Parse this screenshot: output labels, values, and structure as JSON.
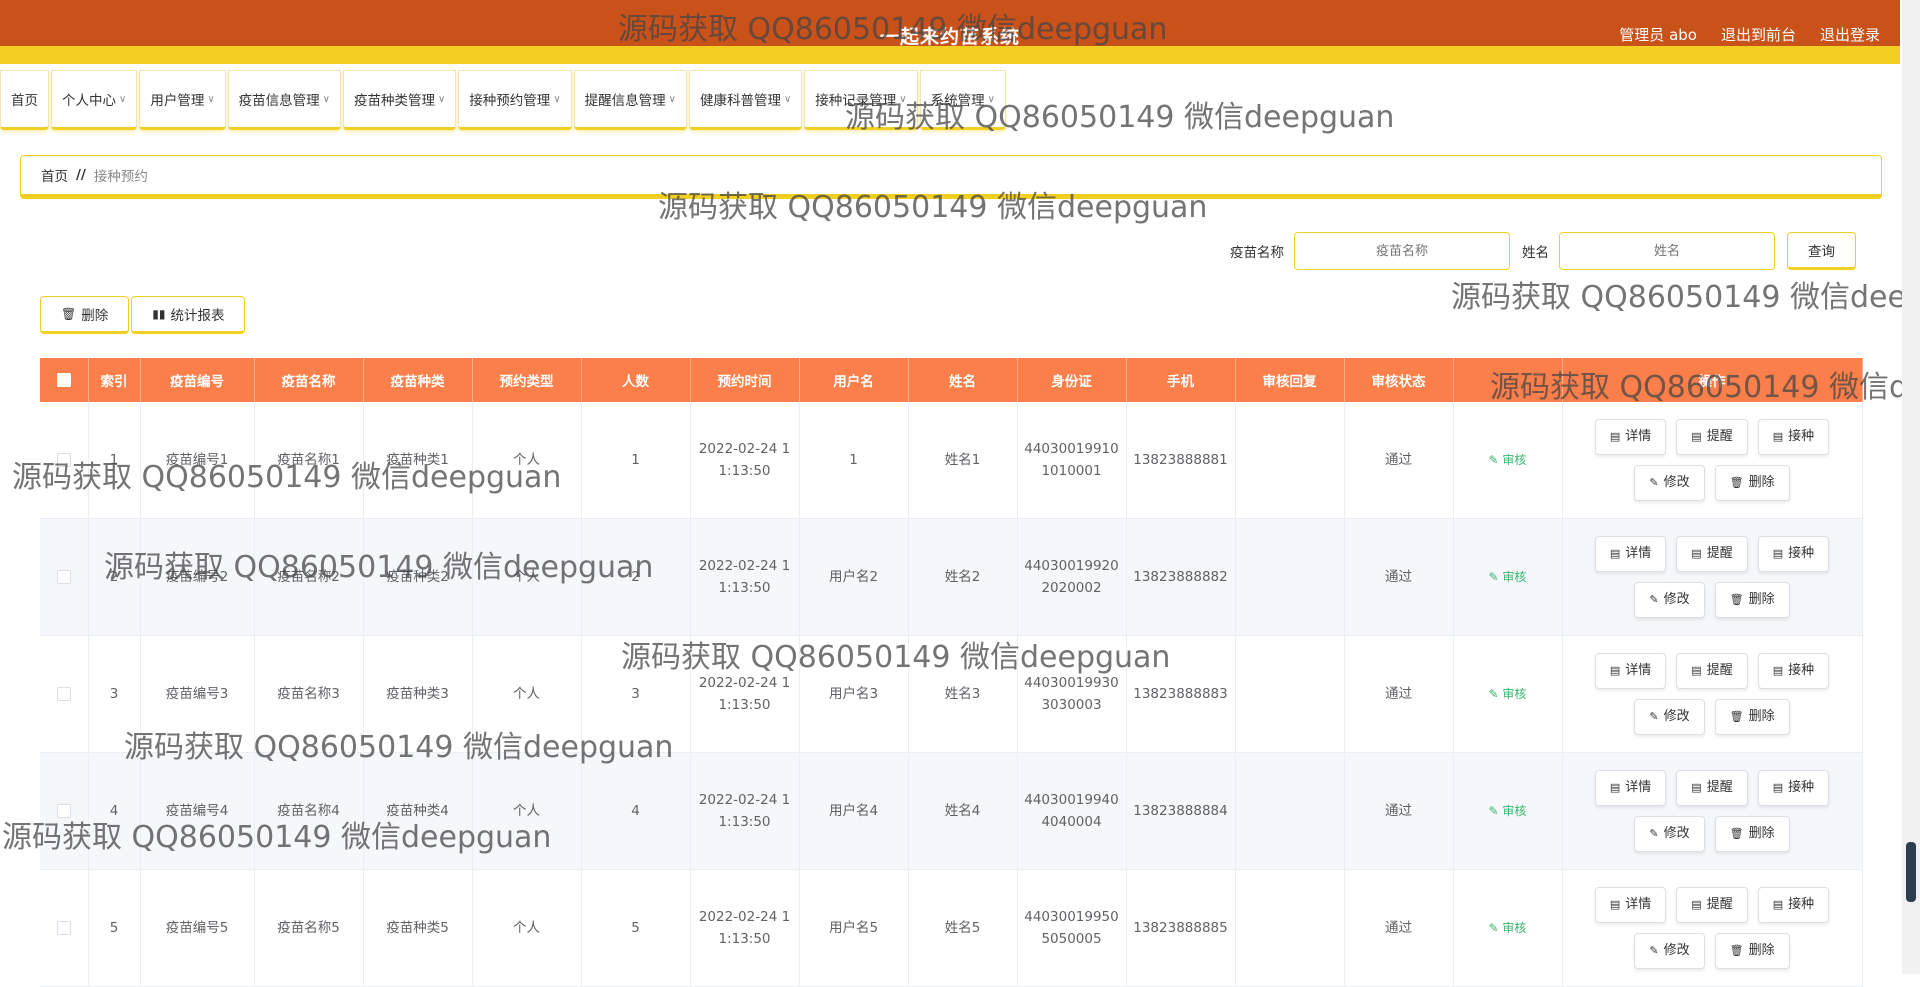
{
  "header": {
    "title": "一起来约苗系统",
    "admin": "管理员 abo",
    "front": "退出到前台",
    "logout": "退出登录"
  },
  "nav": [
    {
      "label": "首页",
      "chevron": ""
    },
    {
      "label": "个人中心",
      "chevron": "∨"
    },
    {
      "label": "用户管理",
      "chevron": "∨"
    },
    {
      "label": "疫苗信息管理",
      "chevron": "∨"
    },
    {
      "label": "疫苗种类管理",
      "chevron": "∨"
    },
    {
      "label": "接种预约管理",
      "chevron": "∨"
    },
    {
      "label": "提醒信息管理",
      "chevron": "∨"
    },
    {
      "label": "健康科普管理",
      "chevron": "∨"
    },
    {
      "label": "接种记录管理",
      "chevron": "∨"
    },
    {
      "label": "系统管理",
      "chevron": "∨"
    }
  ],
  "breadcrumb": {
    "home": "首页",
    "sep": "//",
    "current": "接种预约"
  },
  "search": {
    "name_label": "疫苗名称",
    "name_placeholder": "疫苗名称",
    "person_label": "姓名",
    "person_placeholder": "姓名",
    "query": "查询"
  },
  "actions": {
    "delete": "删除",
    "report": "统计报表"
  },
  "table": {
    "headers": [
      "",
      "索引",
      "疫苗编号",
      "疫苗名称",
      "疫苗种类",
      "预约类型",
      "人数",
      "预约时间",
      "用户名",
      "姓名",
      "身份证",
      "手机",
      "审核回复",
      "审核状态",
      "",
      "操作"
    ],
    "audit_link": "审核",
    "ops": {
      "detail": "详情",
      "remind": "提醒",
      "vaccinate": "接种",
      "edit": "修改",
      "delete": "删除"
    },
    "rows": [
      {
        "index": "1",
        "code": "疫苗编号1",
        "name": "疫苗名称1",
        "type": "疫苗种类1",
        "book_type": "个人",
        "count": "1",
        "time": "2022-02-24 11:13:50",
        "username": "1",
        "person": "姓名1",
        "idcard": "440300199101010001",
        "phone": "13823888881",
        "reply": "",
        "status": "通过"
      },
      {
        "index": "2",
        "code": "疫苗编号2",
        "name": "疫苗名称2",
        "type": "疫苗种类2",
        "book_type": "个人",
        "count": "2",
        "time": "2022-02-24 11:13:50",
        "username": "用户名2",
        "person": "姓名2",
        "idcard": "440300199202020002",
        "phone": "13823888882",
        "reply": "",
        "status": "通过"
      },
      {
        "index": "3",
        "code": "疫苗编号3",
        "name": "疫苗名称3",
        "type": "疫苗种类3",
        "book_type": "个人",
        "count": "3",
        "time": "2022-02-24 11:13:50",
        "username": "用户名3",
        "person": "姓名3",
        "idcard": "440300199303030003",
        "phone": "13823888883",
        "reply": "",
        "status": "通过"
      },
      {
        "index": "4",
        "code": "疫苗编号4",
        "name": "疫苗名称4",
        "type": "疫苗种类4",
        "book_type": "个人",
        "count": "4",
        "time": "2022-02-24 11:13:50",
        "username": "用户名4",
        "person": "姓名4",
        "idcard": "440300199404040004",
        "phone": "13823888884",
        "reply": "",
        "status": "通过"
      },
      {
        "index": "5",
        "code": "疫苗编号5",
        "name": "疫苗名称5",
        "type": "疫苗种类5",
        "book_type": "个人",
        "count": "5",
        "time": "2022-02-24 11:13:50",
        "username": "用户名5",
        "person": "姓名5",
        "idcard": "440300199505050005",
        "phone": "13823888885",
        "reply": "",
        "status": "通过"
      }
    ]
  },
  "watermark": "源码获取 QQ86050149 微信deepguan",
  "colors": {
    "header": "#c9511a",
    "accent": "#f3cf21",
    "table_head": "#fb7f4a",
    "audit": "#3cb371"
  }
}
